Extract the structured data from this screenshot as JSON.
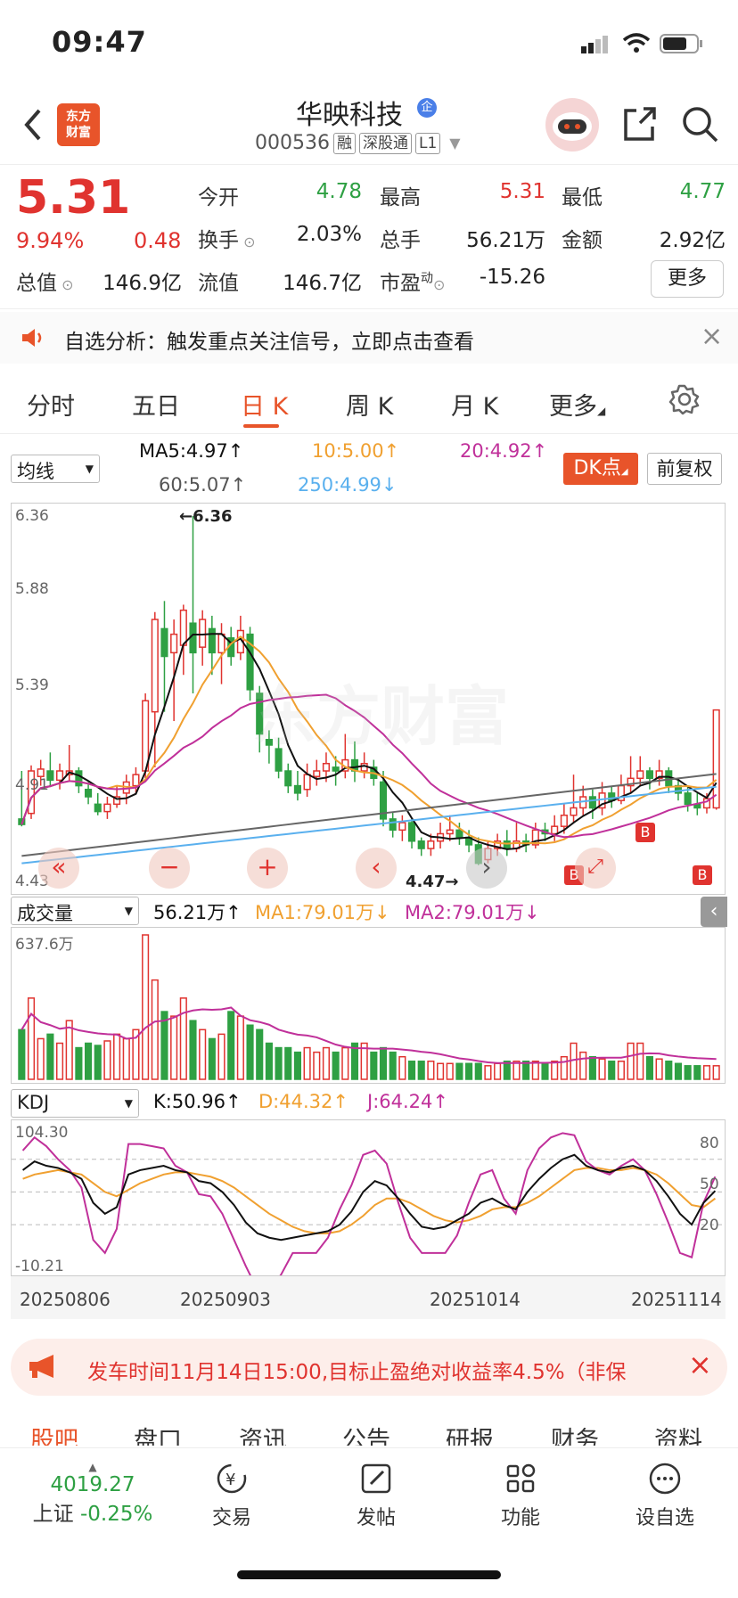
{
  "status": {
    "time": "09:47"
  },
  "header": {
    "logo_text_1": "东方",
    "logo_text_2": "财富",
    "name": "华映科技",
    "qi_badge": "企",
    "code": "000536",
    "tags": [
      "融",
      "深股通",
      "L1"
    ]
  },
  "quote": {
    "price": "5.31",
    "change_pct": "9.94%",
    "change_amt": "0.48",
    "rows": [
      [
        {
          "label": "今开",
          "value": "4.78",
          "color": "green"
        },
        {
          "label": "最高",
          "value": "5.31",
          "color": "red"
        },
        {
          "label": "最低",
          "value": "4.77",
          "color": "green"
        }
      ],
      [
        {
          "label": "换手",
          "value": "2.03%",
          "color": "black"
        },
        {
          "label": "总手",
          "value": "56.21万",
          "color": "black"
        },
        {
          "label": "金额",
          "value": "2.92亿",
          "color": "black"
        }
      ]
    ],
    "total_value_label": "总值",
    "total_value": "146.9亿",
    "float_label": "流值",
    "float_value": "146.7亿",
    "pe_label": "市盈",
    "pe_sup": "动",
    "pe_value": "-15.26",
    "more_label": "更多"
  },
  "notice": {
    "text": "自选分析：触发重点关注信号，立即点击查看",
    "close": "×"
  },
  "tabs": [
    "分时",
    "五日",
    "日 K",
    "周 K",
    "月 K",
    "更多"
  ],
  "active_tab": 2,
  "ma": {
    "selector": "均线",
    "ma5": "MA5:4.97",
    "ma10": "10:5.00",
    "ma20": "20:4.92",
    "ma60": "60:5.07",
    "ma250": "250:4.99",
    "dk_label": "DK点",
    "fuquan_label": "前复权"
  },
  "kchart": {
    "y_labels": [
      "6.36",
      "5.88",
      "5.39",
      "4.91",
      "4.43"
    ],
    "high_mark": "←6.36",
    "low_mark": "4.47→",
    "watermark": "东方财富",
    "b_marks": [
      "B",
      "B",
      "B"
    ]
  },
  "volume": {
    "selector": "成交量",
    "vol": "56.21万",
    "ma1": "MA1:79.01万",
    "ma2": "MA2:79.01万",
    "max_label": "637.6万"
  },
  "kdj": {
    "selector": "KDJ",
    "k": "K:50.96",
    "d": "D:44.32",
    "j": "J:64.24",
    "top_label": "104.30",
    "bottom_label": "-10.21",
    "right_labels": [
      "80",
      "50",
      "20"
    ]
  },
  "dates": [
    "20250806",
    "20250903",
    "20251014",
    "20251114"
  ],
  "promo": {
    "text": "发车时间11月14日15:00,目标止盈绝对收益率4.5%（非保"
  },
  "bottom_tabs": [
    "股吧",
    "盘口",
    "资讯",
    "公告",
    "研报",
    "财务",
    "资料"
  ],
  "footer": {
    "index_value": "4019.27",
    "index_name": "上证",
    "index_change": "-0.25%",
    "items": [
      "交易",
      "发帖",
      "功能",
      "设自选"
    ]
  },
  "colors": {
    "red": "#e0332f",
    "green": "#2ea043",
    "accent": "#e8542a"
  },
  "chart_data": {
    "type": "candlestick",
    "candles": [
      [
        4.72,
        4.69,
        4.98,
        4.68
      ],
      [
        4.75,
        4.98,
        5.01,
        4.72
      ],
      [
        4.95,
        4.99,
        5.04,
        4.9
      ],
      [
        4.98,
        4.93,
        5.08,
        4.9
      ],
      [
        4.93,
        4.98,
        5.02,
        4.88
      ],
      [
        4.96,
        4.98,
        5.12,
        4.92
      ],
      [
        4.98,
        4.9,
        5.0,
        4.86
      ],
      [
        4.88,
        4.84,
        4.92,
        4.8
      ],
      [
        4.8,
        4.76,
        4.86,
        4.74
      ],
      [
        4.76,
        4.8,
        4.84,
        4.72
      ],
      [
        4.8,
        4.84,
        4.9,
        4.78
      ],
      [
        4.86,
        4.92,
        4.96,
        4.8
      ],
      [
        4.9,
        4.96,
        5.0,
        4.86
      ],
      [
        4.98,
        5.36,
        5.4,
        4.94
      ],
      [
        5.3,
        5.8,
        5.84,
        5.0
      ],
      [
        5.75,
        5.6,
        5.9,
        5.3
      ],
      [
        5.62,
        5.72,
        5.8,
        5.25
      ],
      [
        5.66,
        5.85,
        5.88,
        5.5
      ],
      [
        5.78,
        5.62,
        6.36,
        5.4
      ],
      [
        5.65,
        5.8,
        5.85,
        5.55
      ],
      [
        5.75,
        5.62,
        5.82,
        5.5
      ],
      [
        5.62,
        5.72,
        5.78,
        5.45
      ],
      [
        5.7,
        5.6,
        5.76,
        5.55
      ],
      [
        5.62,
        5.74,
        5.82,
        5.58
      ],
      [
        5.72,
        5.42,
        5.76,
        5.36
      ],
      [
        5.4,
        5.18,
        5.44,
        5.08
      ],
      [
        5.15,
        5.12,
        5.2,
        5.02
      ],
      [
        5.1,
        4.98,
        5.16,
        4.94
      ],
      [
        4.98,
        4.9,
        5.02,
        4.86
      ],
      [
        4.9,
        4.86,
        4.98,
        4.82
      ],
      [
        4.88,
        4.96,
        5.02,
        4.84
      ],
      [
        4.95,
        4.98,
        5.04,
        4.9
      ],
      [
        4.98,
        5.02,
        5.08,
        4.92
      ],
      [
        5.0,
        4.98,
        5.06,
        4.9
      ],
      [
        4.98,
        5.04,
        5.18,
        4.94
      ],
      [
        5.04,
        4.98,
        5.14,
        4.92
      ],
      [
        4.98,
        5.02,
        5.08,
        4.94
      ],
      [
        5.0,
        4.94,
        5.04,
        4.9
      ],
      [
        4.92,
        4.72,
        4.98,
        4.68
      ],
      [
        4.72,
        4.66,
        4.76,
        4.62
      ],
      [
        4.66,
        4.7,
        4.74,
        4.6
      ],
      [
        4.7,
        4.6,
        4.72,
        4.56
      ],
      [
        4.6,
        4.56,
        4.62,
        4.52
      ],
      [
        4.56,
        4.6,
        4.64,
        4.52
      ],
      [
        4.6,
        4.64,
        4.7,
        4.56
      ],
      [
        4.64,
        4.66,
        4.74,
        4.6
      ],
      [
        4.66,
        4.62,
        4.7,
        4.58
      ],
      [
        4.62,
        4.58,
        4.66,
        4.54
      ],
      [
        4.58,
        4.48,
        4.62,
        4.47
      ],
      [
        4.5,
        4.56,
        4.6,
        4.48
      ],
      [
        4.56,
        4.6,
        4.64,
        4.52
      ],
      [
        4.6,
        4.56,
        4.66,
        4.52
      ],
      [
        4.56,
        4.6,
        4.7,
        4.54
      ],
      [
        4.6,
        4.58,
        4.64,
        4.54
      ],
      [
        4.58,
        4.66,
        4.7,
        4.56
      ],
      [
        4.66,
        4.64,
        4.7,
        4.6
      ],
      [
        4.64,
        4.68,
        4.74,
        4.6
      ],
      [
        4.68,
        4.74,
        4.8,
        4.64
      ],
      [
        4.74,
        4.78,
        4.96,
        4.7
      ],
      [
        4.78,
        4.84,
        4.9,
        4.74
      ],
      [
        4.84,
        4.78,
        4.88,
        4.72
      ],
      [
        4.78,
        4.86,
        4.92,
        4.74
      ],
      [
        4.86,
        4.82,
        4.9,
        4.78
      ],
      [
        4.82,
        4.9,
        4.96,
        4.8
      ],
      [
        4.9,
        4.94,
        5.06,
        4.86
      ],
      [
        4.94,
        4.98,
        5.06,
        4.9
      ],
      [
        4.98,
        4.94,
        5.0,
        4.88
      ],
      [
        4.94,
        4.98,
        5.04,
        4.9
      ],
      [
        4.98,
        4.9,
        5.0,
        4.86
      ],
      [
        4.9,
        4.86,
        4.94,
        4.82
      ],
      [
        4.86,
        4.8,
        4.9,
        4.76
      ],
      [
        4.8,
        4.78,
        4.86,
        4.74
      ],
      [
        4.78,
        4.83,
        4.86,
        4.75
      ],
      [
        4.78,
        5.31,
        5.31,
        4.77
      ]
    ],
    "volume": [
      2.2,
      3.6,
      1.8,
      2.0,
      1.6,
      2.6,
      1.4,
      1.6,
      1.5,
      1.7,
      2.0,
      1.8,
      2.2,
      6.4,
      4.4,
      3.0,
      2.8,
      3.6,
      2.6,
      2.2,
      1.8,
      2.0,
      3.0,
      2.8,
      2.4,
      2.2,
      1.6,
      1.4,
      1.4,
      1.2,
      1.4,
      1.2,
      1.4,
      1.2,
      1.4,
      1.6,
      1.6,
      1.2,
      1.4,
      1.2,
      1.0,
      0.8,
      0.8,
      0.8,
      0.7,
      0.7,
      0.7,
      0.7,
      0.7,
      0.6,
      0.7,
      0.8,
      0.8,
      0.8,
      0.8,
      0.7,
      0.8,
      1.0,
      1.6,
      1.2,
      1.0,
      0.9,
      0.8,
      0.8,
      1.6,
      1.6,
      1.0,
      0.9,
      0.8,
      0.7,
      0.6,
      0.6,
      0.6,
      0.6
    ],
    "kdj_k": [
      70,
      78,
      74,
      72,
      68,
      62,
      40,
      30,
      36,
      66,
      70,
      72,
      74,
      70,
      68,
      60,
      58,
      50,
      38,
      22,
      12,
      8,
      6,
      8,
      10,
      12,
      14,
      20,
      32,
      50,
      60,
      56,
      44,
      30,
      18,
      16,
      18,
      24,
      30,
      40,
      44,
      38,
      34,
      50,
      62,
      72,
      80,
      84,
      74,
      70,
      68,
      72,
      74,
      70,
      60,
      46,
      30,
      20,
      40,
      51
    ],
    "kdj_d": [
      62,
      66,
      68,
      70,
      68,
      66,
      58,
      50,
      46,
      52,
      58,
      62,
      66,
      68,
      68,
      66,
      64,
      60,
      54,
      46,
      38,
      30,
      24,
      18,
      14,
      12,
      12,
      14,
      20,
      28,
      38,
      44,
      44,
      40,
      34,
      28,
      24,
      22,
      24,
      28,
      34,
      36,
      36,
      40,
      46,
      54,
      62,
      70,
      72,
      72,
      70,
      70,
      72,
      70,
      66,
      58,
      48,
      38,
      36,
      44
    ],
    "kdj_j": [
      88,
      100,
      92,
      80,
      70,
      54,
      6,
      -6,
      16,
      94,
      94,
      92,
      90,
      74,
      68,
      48,
      46,
      30,
      6,
      -18,
      -40,
      -40,
      -26,
      -6,
      -6,
      -6,
      8,
      34,
      56,
      84,
      88,
      76,
      40,
      8,
      -6,
      -6,
      -6,
      10,
      40,
      66,
      70,
      44,
      30,
      70,
      90,
      100,
      104,
      102,
      78,
      70,
      66,
      74,
      80,
      70,
      48,
      22,
      -6,
      -10,
      40,
      64
    ],
    "y_range": [
      4.43,
      6.36
    ]
  }
}
